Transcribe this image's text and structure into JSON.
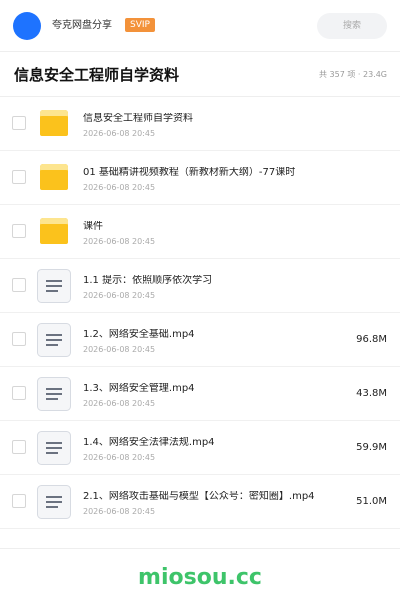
{
  "header": {
    "account_name": "夸克网盘分享",
    "badge": "SVIP",
    "search_placeholder": "搜索",
    "avatar_color": "#1e73ff"
  },
  "title_bar": {
    "title": "信息安全工程师自学资料",
    "summary": "共 357 项 · 23.4G"
  },
  "files": [
    {
      "type": "folder",
      "name": "信息安全工程师自学资料",
      "date": "2026-06-08 20:45",
      "size": ""
    },
    {
      "type": "folder",
      "name": "01 基础精讲视频教程（新教材新大纲）-77课时",
      "date": "2026-06-08 20:45",
      "size": ""
    },
    {
      "type": "folder",
      "name": "课件",
      "date": "2026-06-08 20:45",
      "size": ""
    },
    {
      "type": "file",
      "name": "1.1 提示：依照顺序依次学习",
      "date": "2026-06-08 20:45",
      "size": ""
    },
    {
      "type": "file",
      "name": "1.2、网络安全基础.mp4",
      "date": "2026-06-08 20:45",
      "size": "96.8M"
    },
    {
      "type": "file",
      "name": "1.3、网络安全管理.mp4",
      "date": "2026-06-08 20:45",
      "size": "43.8M"
    },
    {
      "type": "file",
      "name": "1.4、网络安全法律法规.mp4",
      "date": "2026-06-08 20:45",
      "size": "59.9M"
    },
    {
      "type": "file",
      "name": "2.1、网络攻击基础与模型【公众号：密知圈】.mp4",
      "date": "2026-06-08 20:45",
      "size": "51.0M"
    }
  ],
  "footer": {
    "watermark": "miosou.cc"
  },
  "colors": {
    "accent_blue": "#1e73ff",
    "badge_orange": "#f3923a",
    "folder_yellow": "#fbc21c",
    "watermark_green": "#3ec46a"
  }
}
